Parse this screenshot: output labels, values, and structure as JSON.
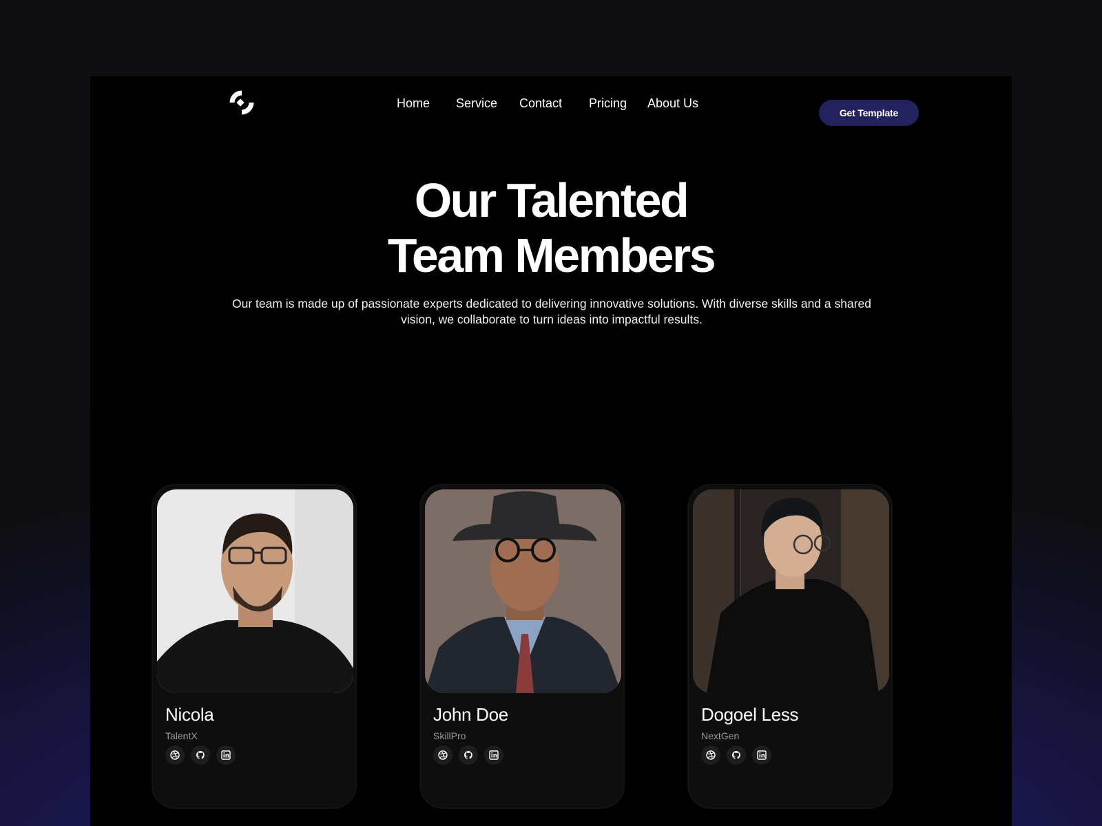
{
  "nav": {
    "items": [
      {
        "label": "Home"
      },
      {
        "label": "Service"
      },
      {
        "label": "Contact"
      },
      {
        "label": "Pricing"
      },
      {
        "label": "About Us"
      }
    ],
    "cta_label": "Get Template",
    "logo_icon": "logo-icon"
  },
  "hero": {
    "title_line1": "Our Talented",
    "title_line2": "Team Members",
    "description": "Our team is made up of passionate experts dedicated to delivering innovative solutions. With diverse skills and a shared vision, we collaborate to turn ideas into impactful results."
  },
  "team": [
    {
      "name": "Nicola",
      "company": "TalentX"
    },
    {
      "name": "John Doe",
      "company": "SkillPro"
    },
    {
      "name": "Dogoel Less",
      "company": "NextGen"
    }
  ],
  "social_icons": [
    "dribbble-icon",
    "github-icon",
    "linkedin-icon"
  ],
  "colors": {
    "accent": "#24215f",
    "page_background": "#000000",
    "card_background": "#0e0e0e",
    "muted_text": "#9a9a9a"
  }
}
